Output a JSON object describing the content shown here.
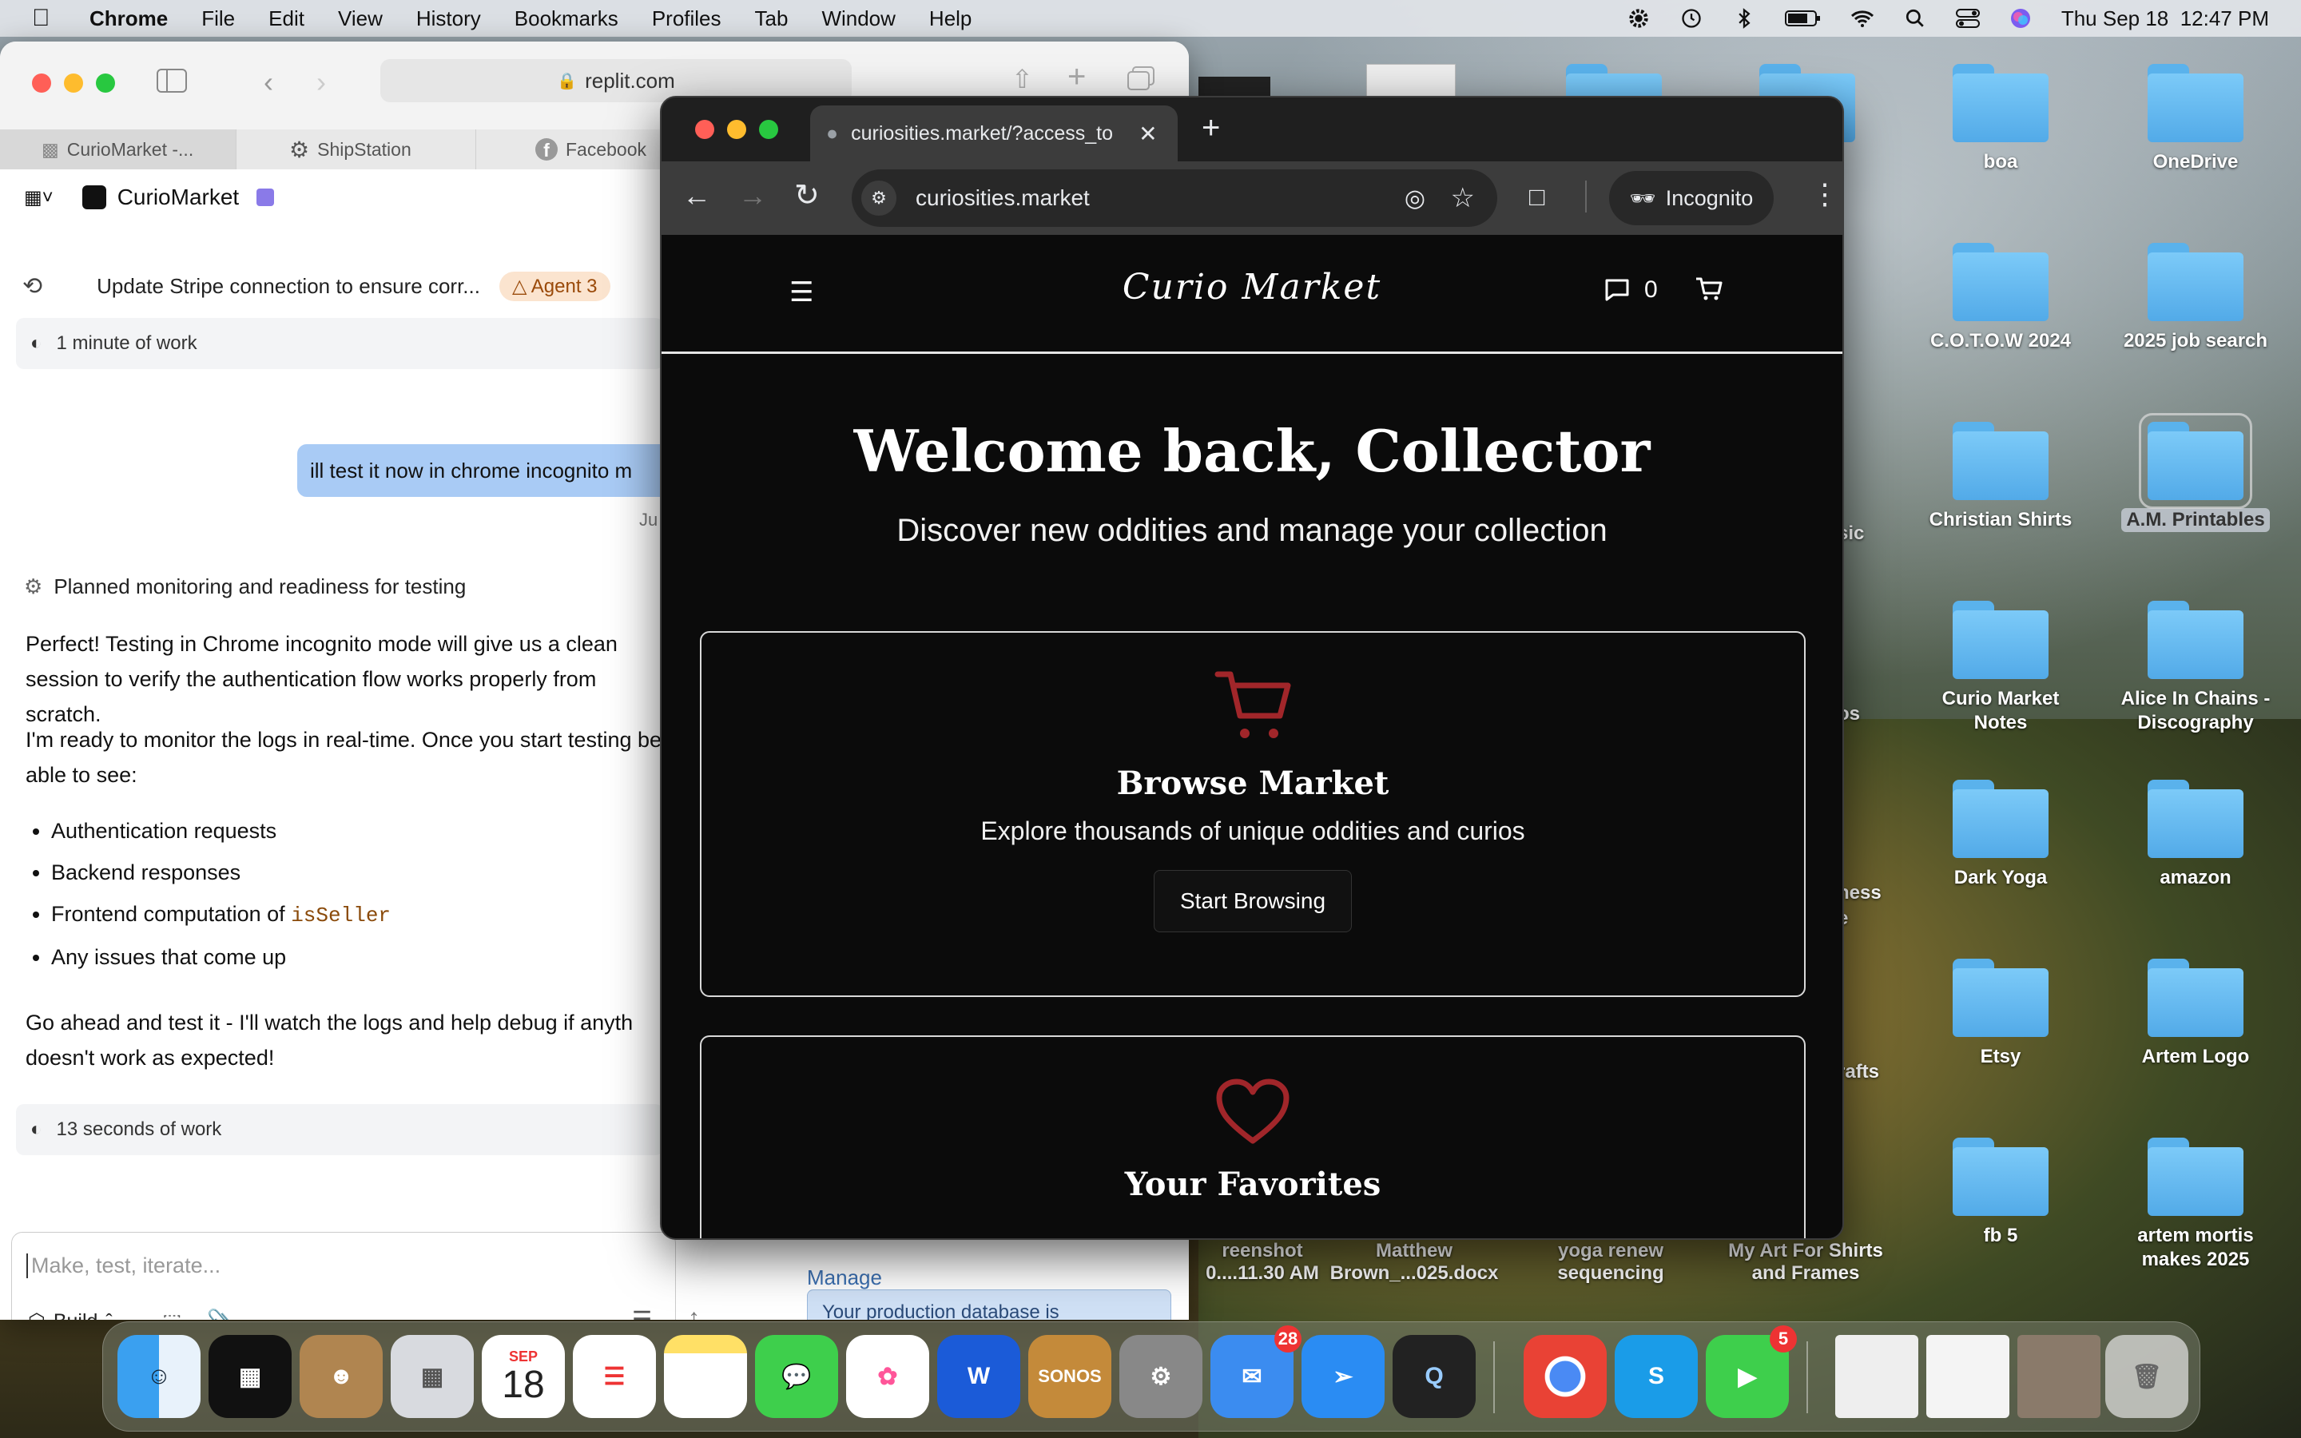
{
  "menubar": {
    "app": "Chrome",
    "items": [
      "File",
      "Edit",
      "View",
      "History",
      "Bookmarks",
      "Profiles",
      "Tab",
      "Window",
      "Help"
    ],
    "clock": "Thu Sep 18  12:47 PM"
  },
  "desktop": {
    "icons": [
      {
        "label": "boa"
      },
      {
        "label": "OneDrive"
      },
      {
        "label": "C.O.T.O.W 2024"
      },
      {
        "label": "2025 job search"
      },
      {
        "label": "Christian Shirts"
      },
      {
        "label": "A.M. Printables"
      },
      {
        "label": "Curio Market Notes"
      },
      {
        "label": "Alice In Chains - Discography"
      },
      {
        "label": "Dark Yoga"
      },
      {
        "label": "amazon"
      },
      {
        "label": "Etsy"
      },
      {
        "label": "Artem Logo"
      },
      {
        "label": "fb 5"
      },
      {
        "label": "artem mortis makes 2025"
      }
    ],
    "partials": [
      "sic",
      "os",
      "ness",
      "e",
      "rafts"
    ],
    "bottom_row": [
      {
        "label": "reenshot\n0....11.30 AM"
      },
      {
        "label": "Matthew\nBrown_...025.docx"
      },
      {
        "label": "yoga renew\nsequencing"
      },
      {
        "label": "My Art For Shirts\nand Frames"
      }
    ]
  },
  "back_window": {
    "url": "replit.com",
    "tabs": [
      "CurioMarket -...",
      "ShipStation",
      "Facebook"
    ],
    "project": "CurioMarket",
    "task_title": "Update Stripe connection to ensure corr...",
    "agent_badge": "Agent 3",
    "work1": "1 minute of work",
    "user_message": "ill test it now in chrome incognito m",
    "timestamp": "Ju",
    "planned": "Planned monitoring and readiness for testing",
    "para1": "Perfect! Testing in Chrome incognito mode will give us a clean session to verify the authentication flow works properly from scratch.",
    "para2": "I'm ready to monitor the logs in real-time. Once you start testing be able to see:",
    "bullets": [
      "Authentication requests",
      "Backend responses",
      "Frontend computation of",
      "Any issues that come up"
    ],
    "code_word": "isSeller",
    "para3": "Go ahead and test it - I'll watch the logs and help debug if anyth doesn't work as expected!",
    "work2": "13 seconds of work",
    "input_placeholder": "Make, test, iterate...",
    "build_label": "Build",
    "side_heading": "Manage",
    "side_note": "Your production database is"
  },
  "chrome": {
    "tab_title": "curiosities.market/?access_to",
    "url": "curiosities.market",
    "incognito_label": "Incognito"
  },
  "site": {
    "logo": "Curio Market",
    "message_count": "0",
    "welcome": "Welcome back, Collector",
    "subtitle": "Discover new oddities and manage your collection",
    "card1": {
      "title": "Browse Market",
      "desc": "Explore thousands of unique oddities and curios",
      "button": "Start Browsing"
    },
    "card2": {
      "title": "Your Favorites"
    }
  },
  "dock": {
    "calendar_month": "SEP",
    "calendar_day": "18",
    "sonos": "SONOS",
    "mail_badge": "28",
    "facetime_badge": "5"
  },
  "colors": {
    "accent_red": "#b0282c",
    "bubble": "#a9cbf5",
    "folder": "#5eb6f0"
  }
}
